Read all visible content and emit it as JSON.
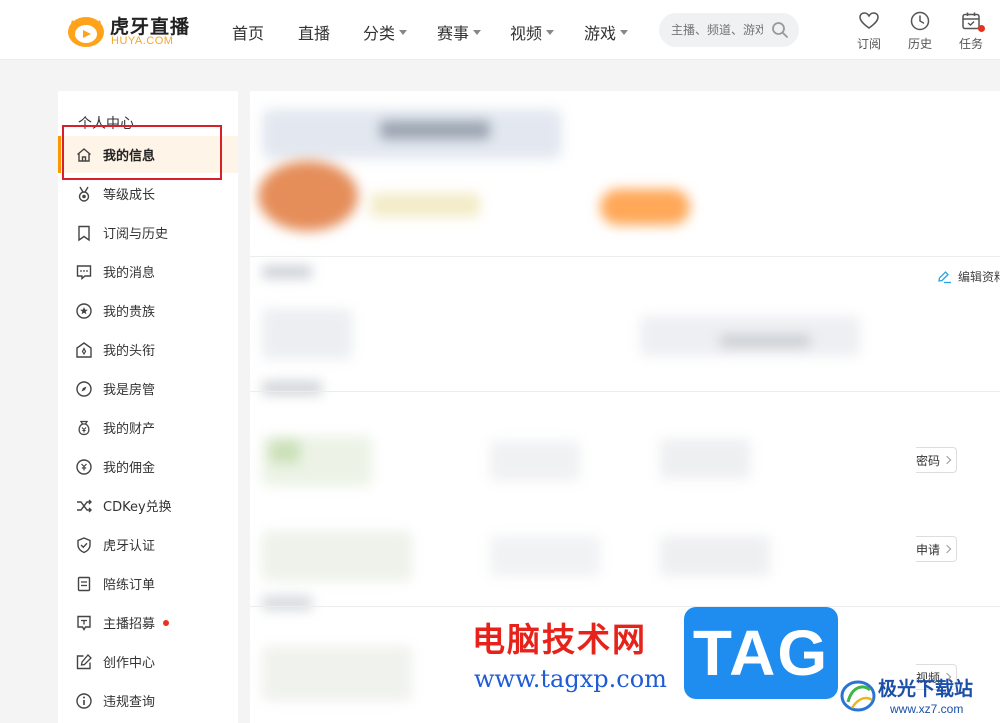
{
  "header": {
    "logo_text": "虎牙直播",
    "logo_sub": "HUYA.COM",
    "nav": [
      {
        "label": "首页",
        "has_caret": false
      },
      {
        "label": "直播",
        "has_caret": false
      },
      {
        "label": "分类",
        "has_caret": true
      },
      {
        "label": "赛事",
        "has_caret": true
      },
      {
        "label": "视频",
        "has_caret": true
      },
      {
        "label": "游戏",
        "has_caret": true
      }
    ],
    "search_placeholder": "主播、频道、游戏",
    "tools": [
      {
        "label": "订阅",
        "icon": "heart-icon"
      },
      {
        "label": "历史",
        "icon": "clock-icon"
      },
      {
        "label": "任务",
        "icon": "calendar-icon",
        "badge": true
      }
    ]
  },
  "sidebar": {
    "title": "个人中心",
    "items": [
      {
        "label": "我的信息",
        "icon": "home-icon",
        "active": true
      },
      {
        "label": "等级成长",
        "icon": "medal-icon"
      },
      {
        "label": "订阅与历史",
        "icon": "bookmark-icon"
      },
      {
        "label": "我的消息",
        "icon": "message-icon"
      },
      {
        "label": "我的贵族",
        "icon": "star-badge-icon"
      },
      {
        "label": "我的头衔",
        "icon": "title-icon"
      },
      {
        "label": "我是房管",
        "icon": "compass-icon"
      },
      {
        "label": "我的财产",
        "icon": "money-bag-icon"
      },
      {
        "label": "我的佣金",
        "icon": "commission-icon"
      },
      {
        "label": "CDKey兑换",
        "icon": "shuffle-icon"
      },
      {
        "label": "虎牙认证",
        "icon": "shield-check-icon"
      },
      {
        "label": "陪练订单",
        "icon": "order-icon"
      },
      {
        "label": "主播招募",
        "icon": "recruit-icon",
        "badge": true
      },
      {
        "label": "创作中心",
        "icon": "edit-icon"
      },
      {
        "label": "违规查询",
        "icon": "info-icon"
      }
    ]
  },
  "main": {
    "edit_profile": "编辑资料",
    "password_btn": "密码",
    "apply_btn": "申请",
    "video_btn": "视频"
  },
  "watermark": {
    "title": "电脑技术网",
    "url": "www.tagxp.com",
    "tag": "TAG",
    "site_name": "极光下载站",
    "site_url": "www.xz7.com"
  },
  "colors": {
    "accent": "#ff9600",
    "highlight_border": "#d8202a",
    "active_bg": "#fff4e8"
  }
}
